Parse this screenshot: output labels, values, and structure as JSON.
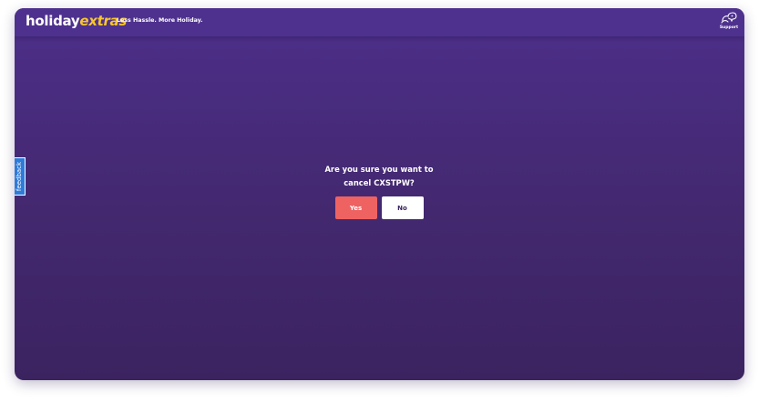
{
  "header": {
    "logo_part1": "holiday",
    "logo_part2": "extras",
    "tagline": "Less Hassle. More Holiday.",
    "support_label": "Support",
    "support_icon": "support-chat-icon"
  },
  "feedback": {
    "label": "feedback"
  },
  "dialog": {
    "question_line1": "Are you sure you want to",
    "question_line2": "cancel CXSTPW?",
    "yes_label": "Yes",
    "no_label": "No"
  },
  "colors": {
    "header_bg": "#4e318e",
    "background": "#43286f",
    "logo_accent": "#f7c62f",
    "yes_button": "#ef6262",
    "no_button": "#ffffff",
    "feedback_tab": "#2f7bd9"
  }
}
